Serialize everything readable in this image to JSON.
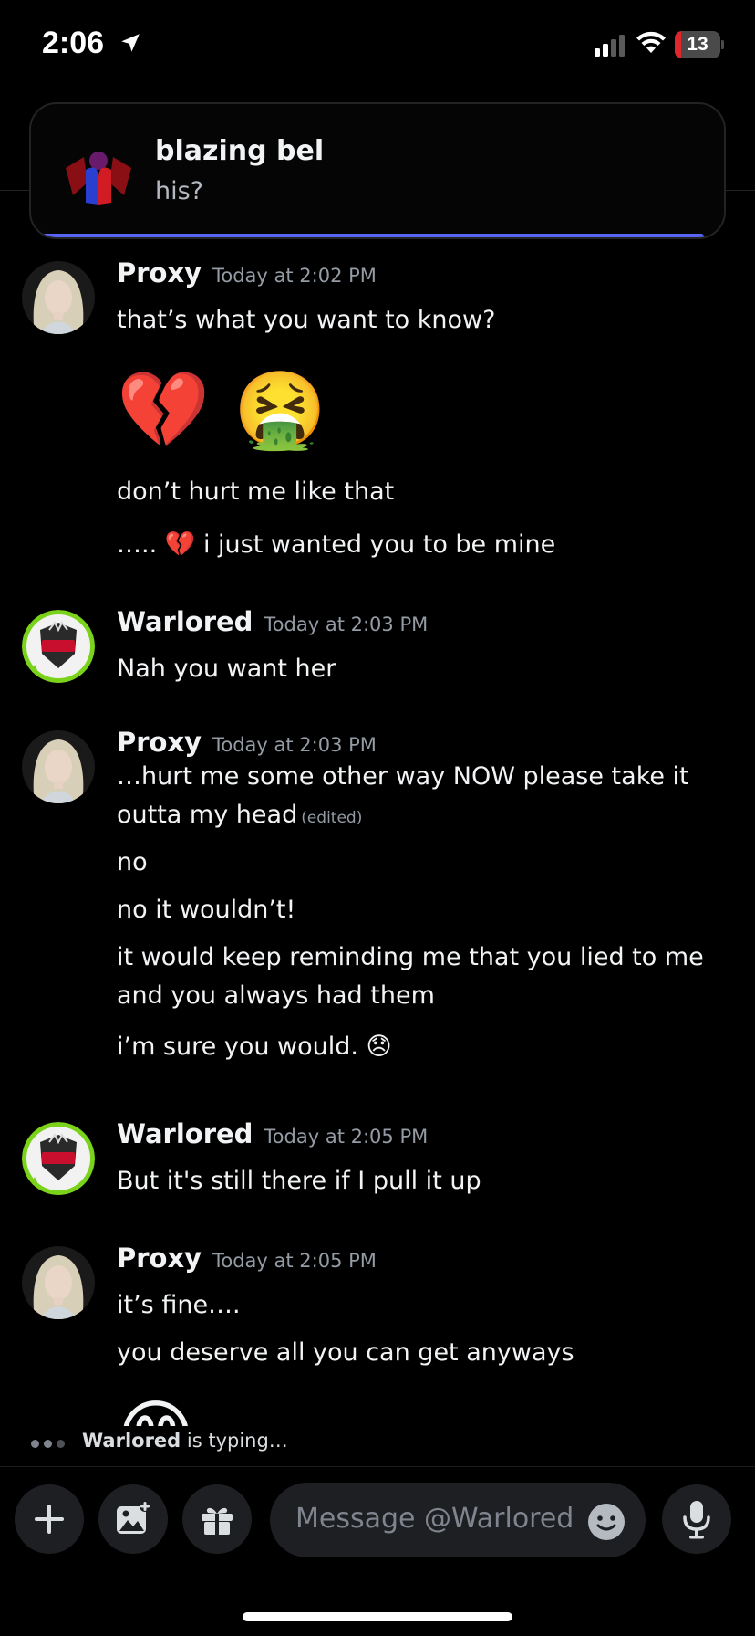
{
  "status_bar": {
    "time": "2:06",
    "battery_level": "13",
    "battery_fraction": 0.13,
    "icons": [
      "location-arrow-icon",
      "cellular-signal-icon",
      "wifi-icon",
      "battery-icon"
    ]
  },
  "notification": {
    "title": "blazing bel",
    "body": "his?"
  },
  "messages": [
    {
      "user": "Proxy",
      "timestamp": "Today at 2:02 PM",
      "lines": [
        "that’s what you want to know?",
        "💔 🤮",
        "don’t hurt me like that",
        "….. 💔 i just wanted you to be mine"
      ]
    },
    {
      "user": "Warlored",
      "timestamp": "Today at 2:03 PM",
      "lines": [
        "Nah you want her"
      ]
    },
    {
      "user": "Proxy",
      "timestamp": "Today at 2:03 PM",
      "lines": [
        "…hurt me some other way NOW please take it outta my head",
        "no",
        "no it wouldn’t!",
        "it would keep reminding me that you lied to me and you always had them",
        "i’m sure you would. 😞"
      ],
      "edited_label": "(edited)"
    },
    {
      "user": "Warlored",
      "timestamp": "Today at 2:05 PM",
      "lines": [
        "But it's still there if I pull it up"
      ]
    },
    {
      "user": "Proxy",
      "timestamp": "Today at 2:05 PM",
      "lines": [
        "it’s fine….",
        "you deserve all you can get anyways",
        "😊"
      ]
    }
  ],
  "typing_indicator": {
    "user": "Warlored",
    "text": "is typing…"
  },
  "composer": {
    "placeholder": "Message @Warlored",
    "icons": [
      "plus-icon",
      "image-icon",
      "gift-icon",
      "emoji-icon",
      "microphone-icon"
    ]
  },
  "colors": {
    "background": "#000000",
    "accent": "#5865f2",
    "battery_low": "#e0262b",
    "muted_text": "#949ba4",
    "input_bg": "#1e1f22"
  }
}
